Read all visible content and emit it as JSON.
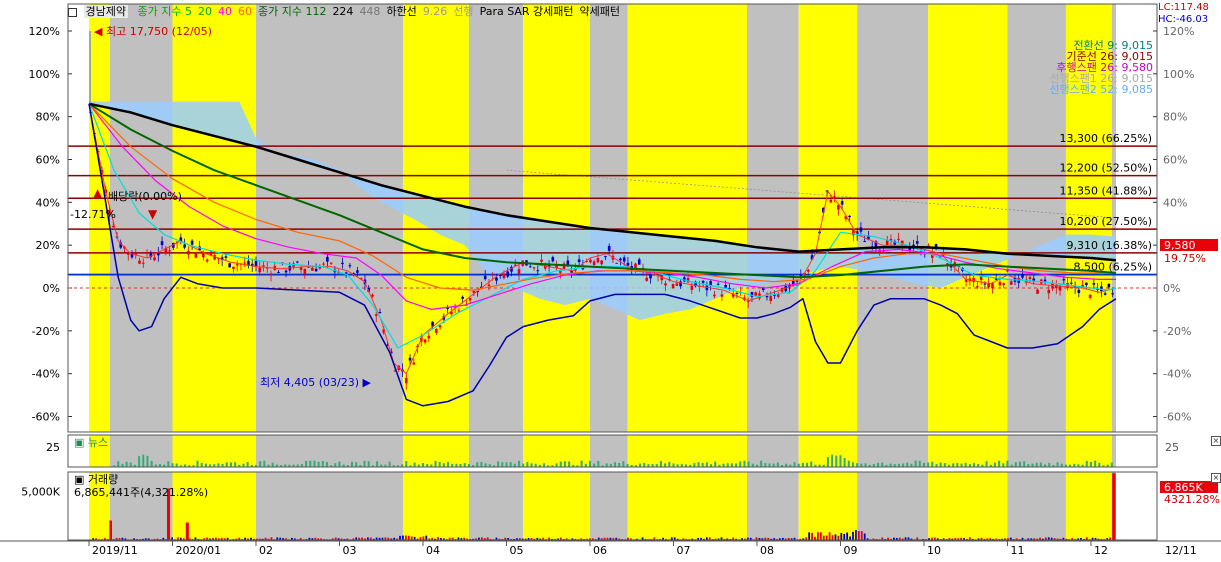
{
  "stock_name": "경남제약",
  "legend_main": [
    {
      "text": "종가 지수 5",
      "color": "#00aa00"
    },
    {
      "text": "20",
      "color": "#00aa00"
    },
    {
      "text": "40",
      "color": "#ff00ff"
    },
    {
      "text": "60",
      "color": "#ff6600"
    },
    {
      "text": "종가 지수 112",
      "color": "#006600"
    },
    {
      "text": "224",
      "color": "#000000"
    },
    {
      "text": "448",
      "color": "#777777"
    },
    {
      "text": "하한선",
      "color": "#000000"
    },
    {
      "text": "9.26",
      "color": "#999999"
    },
    {
      "text": "선행",
      "color": "#999999"
    },
    {
      "text": "Para SAR 강세패턴",
      "color": "#000000"
    },
    {
      "text": "약세패턴",
      "color": "#000000"
    }
  ],
  "lc_label": "LC:117.48",
  "hc_label": "HC:-46.03",
  "ichimoku_labels": [
    {
      "text": "전환선 9: 9,015",
      "color": "#008080"
    },
    {
      "text": "기준선 26: 9,015",
      "color": "#880000"
    },
    {
      "text": "후행스팬 26: 9,580",
      "color": "#cc00cc"
    },
    {
      "text": "선행스팬1 26: 9,015",
      "color": "#aaaaaa"
    },
    {
      "text": "선행스팬2 52: 9,085",
      "color": "#66aaff"
    }
  ],
  "max_label": "최고 17,750 (12/05)",
  "min_label": "최저 4,405 (03/23)",
  "dividend_label": "배당락(0.00%)",
  "first_pct_label": "-12.71%",
  "price_levels": [
    {
      "text": "13,300 (66.25%)",
      "pct": 66.25
    },
    {
      "text": "12,200 (52.50%)",
      "pct": 52.5
    },
    {
      "text": "11,350 (41.88%)",
      "pct": 41.88
    },
    {
      "text": "10,200 (27.50%)",
      "pct": 27.5
    },
    {
      "text": "9,310 (16.38%)",
      "pct": 16.38
    },
    {
      "text": "8,500 (6.25%)",
      "pct": 6.25
    }
  ],
  "current_price_label": "9,580",
  "current_pct_label": "19.75%",
  "news_title": "뉴스",
  "volume_title": "거래량",
  "volume_info": "6,865,441주(4,321.28%)",
  "volume_right_label": "6,865K",
  "volume_right_pct": "4321.28%",
  "date_right": "12/11",
  "colors": {
    "yellow_band": "#ffff00",
    "gray_band": "#c0c0c0",
    "up": "#e8000b",
    "down": "#0000cc",
    "ichimoku_cloud": "#99ccff",
    "level_line": "#8b0000",
    "blue_line": "#0033cc",
    "news_bar": "#33aa77"
  },
  "chart_data": {
    "type": "line",
    "title": "경남제약",
    "xlabel": "",
    "ylabel": "",
    "ylim": [
      -65,
      130
    ],
    "y_ticks": [
      120,
      100,
      80,
      60,
      40,
      20,
      0,
      -20,
      -40,
      -60
    ],
    "y_tick_labels": [
      "120%",
      "100%",
      "80%",
      "60%",
      "40%",
      "20%",
      "0%",
      "-20%",
      "-40%",
      "-60%"
    ],
    "x_range": [
      0,
      12.3
    ],
    "x_ticks": [
      {
        "x": 0,
        "label": "2019/11"
      },
      {
        "x": 1,
        "label": "2020/01"
      },
      {
        "x": 2,
        "label": "02"
      },
      {
        "x": 3,
        "label": "03"
      },
      {
        "x": 4,
        "label": "04"
      },
      {
        "x": 5,
        "label": "05"
      },
      {
        "x": 6,
        "label": "06"
      },
      {
        "x": 7,
        "label": "07"
      },
      {
        "x": 8,
        "label": "08"
      },
      {
        "x": 9,
        "label": "09"
      },
      {
        "x": 10,
        "label": "10"
      },
      {
        "x": 11,
        "label": "11"
      },
      {
        "x": 12,
        "label": "12"
      }
    ],
    "bands": [
      {
        "from": 0.0,
        "to": 0.25,
        "kind": "yellow"
      },
      {
        "from": 0.25,
        "to": 1.0,
        "kind": "gray"
      },
      {
        "from": 1.0,
        "to": 2.0,
        "kind": "yellow"
      },
      {
        "from": 2.0,
        "to": 3.76,
        "kind": "gray"
      },
      {
        "from": 3.76,
        "to": 4.55,
        "kind": "yellow"
      },
      {
        "from": 4.55,
        "to": 5.2,
        "kind": "gray"
      },
      {
        "from": 5.2,
        "to": 6.0,
        "kind": "yellow"
      },
      {
        "from": 6.0,
        "to": 6.45,
        "kind": "gray"
      },
      {
        "from": 6.45,
        "to": 7.88,
        "kind": "yellow"
      },
      {
        "from": 7.88,
        "to": 8.5,
        "kind": "gray"
      },
      {
        "from": 8.5,
        "to": 9.2,
        "kind": "yellow"
      },
      {
        "from": 9.2,
        "to": 10.05,
        "kind": "gray"
      },
      {
        "from": 10.05,
        "to": 10.75,
        "kind": "yellow"
      },
      {
        "from": 10.75,
        "to": 11.7,
        "kind": "yellow"
      },
      {
        "from": 11.0,
        "to": 11.7,
        "kind": "gray"
      },
      {
        "from": 11.7,
        "to": 12.25,
        "kind": "yellow"
      },
      {
        "from": 12.25,
        "to": 12.3,
        "kind": "gray"
      }
    ],
    "series": [
      {
        "name": "5",
        "color": "#ff3333",
        "width": 1,
        "x": [
          0,
          0.2,
          0.35,
          0.5,
          0.7,
          0.9,
          1.1,
          1.4,
          1.7,
          2.0,
          2.3,
          2.6,
          2.9,
          3.1,
          3.3,
          3.5,
          3.65,
          3.8,
          4.0,
          4.3,
          4.6,
          4.9,
          5.2,
          5.5,
          5.8,
          6.0,
          6.2,
          6.5,
          6.8,
          7.0,
          7.3,
          7.6,
          7.9,
          8.2,
          8.5,
          8.7,
          8.85,
          9.0,
          9.2,
          9.5,
          9.8,
          10.0,
          10.2,
          10.5,
          10.8,
          11.0,
          11.3,
          11.6,
          11.9,
          12.1,
          12.3
        ],
        "y": [
          86,
          45,
          22,
          16,
          14,
          18,
          22,
          16,
          12,
          10,
          9,
          10,
          10,
          8,
          3,
          -15,
          -35,
          -40,
          -22,
          -12,
          -3,
          6,
          12,
          10,
          8,
          14,
          16,
          9,
          6,
          3,
          1,
          -1,
          -6,
          -2,
          2,
          16,
          45,
          38,
          25,
          20,
          20,
          18,
          16,
          4,
          2,
          6,
          2,
          1,
          0,
          -2,
          0
        ]
      },
      {
        "name": "20",
        "color": "#00dddd",
        "width": 1.2,
        "x": [
          0,
          0.3,
          0.6,
          0.9,
          1.2,
          1.6,
          2.0,
          2.4,
          2.8,
          3.1,
          3.4,
          3.7,
          4.0,
          4.4,
          4.8,
          5.2,
          5.6,
          6.0,
          6.4,
          6.8,
          7.2,
          7.6,
          8.0,
          8.4,
          8.7,
          9.0,
          9.4,
          9.8,
          10.2,
          10.6,
          11.0,
          11.4,
          11.8,
          12.2,
          12.3
        ],
        "y": [
          86,
          55,
          35,
          25,
          20,
          16,
          13,
          11,
          10,
          6,
          -8,
          -28,
          -22,
          -12,
          -4,
          4,
          8,
          10,
          10,
          7,
          3,
          0,
          -4,
          -2,
          8,
          26,
          24,
          20,
          14,
          6,
          4,
          3,
          1,
          -1,
          0
        ]
      },
      {
        "name": "40",
        "color": "#ff00ff",
        "width": 1.2,
        "x": [
          0,
          0.4,
          0.8,
          1.2,
          1.6,
          2.0,
          2.4,
          2.8,
          3.2,
          3.5,
          3.8,
          4.1,
          4.5,
          4.9,
          5.3,
          5.7,
          6.1,
          6.5,
          6.9,
          7.3,
          7.7,
          8.1,
          8.5,
          8.9,
          9.3,
          9.7,
          10.1,
          10.5,
          10.9,
          11.3,
          11.7,
          12.1,
          12.3
        ],
        "y": [
          86,
          66,
          50,
          38,
          29,
          23,
          19,
          16,
          14,
          6,
          -6,
          -10,
          -8,
          -3,
          2,
          6,
          8,
          8,
          7,
          5,
          2,
          0,
          2,
          10,
          17,
          18,
          16,
          12,
          9,
          7,
          5,
          4,
          4
        ]
      },
      {
        "name": "60",
        "color": "#ff6600",
        "width": 1.2,
        "x": [
          0,
          0.5,
          1.0,
          1.5,
          2.0,
          2.5,
          3.0,
          3.4,
          3.8,
          4.2,
          4.6,
          5.0,
          5.4,
          5.8,
          6.2,
          6.6,
          7.0,
          7.4,
          7.8,
          8.2,
          8.6,
          9.0,
          9.4,
          9.8,
          10.2,
          10.6,
          11.0,
          11.4,
          11.8,
          12.3
        ],
        "y": [
          86,
          66,
          51,
          40,
          32,
          26,
          22,
          15,
          5,
          0,
          -1,
          2,
          5,
          7,
          8,
          8,
          7,
          6,
          4,
          3,
          4,
          10,
          14,
          16,
          16,
          13,
          10,
          8,
          7,
          7
        ]
      },
      {
        "name": "112",
        "color": "#006600",
        "width": 2,
        "x": [
          0,
          0.5,
          1.0,
          1.5,
          2.0,
          2.5,
          3.0,
          3.5,
          4.0,
          4.5,
          5.0,
          5.5,
          6.0,
          6.5,
          7.0,
          7.5,
          8.0,
          8.5,
          9.0,
          9.5,
          10.0,
          10.5,
          11.0,
          11.5,
          12.0,
          12.3
        ],
        "y": [
          86,
          74,
          64,
          55,
          48,
          41,
          34,
          26,
          18,
          14,
          12,
          11,
          10,
          9,
          8,
          7,
          6,
          5,
          6,
          8,
          10,
          11,
          10,
          9,
          8,
          7
        ]
      },
      {
        "name": "224",
        "color": "#000000",
        "width": 2.5,
        "x": [
          0,
          0.5,
          1.0,
          1.5,
          2.0,
          2.5,
          3.0,
          3.5,
          4.0,
          4.5,
          5.0,
          5.5,
          6.0,
          6.5,
          7.0,
          7.5,
          8.0,
          8.5,
          9.0,
          9.5,
          10.0,
          10.5,
          11.0,
          11.5,
          12.0,
          12.3
        ],
        "y": [
          86,
          82,
          76,
          71,
          66,
          60,
          54,
          48,
          43,
          38,
          34,
          31,
          28,
          26,
          24,
          22,
          19,
          17,
          18,
          19,
          19,
          18,
          16,
          15,
          14,
          13
        ]
      },
      {
        "name": "하한선",
        "color": "#0000aa",
        "width": 1.5,
        "x": [
          0,
          0.2,
          0.35,
          0.5,
          0.6,
          0.75,
          0.9,
          1.1,
          1.3,
          1.6,
          2.0,
          2.5,
          3.0,
          3.3,
          3.6,
          3.8,
          4.0,
          4.3,
          4.6,
          4.8,
          5.0,
          5.2,
          5.5,
          5.8,
          6.0,
          6.3,
          6.6,
          6.9,
          7.2,
          7.5,
          7.8,
          8.0,
          8.2,
          8.4,
          8.55,
          8.7,
          8.85,
          9.0,
          9.2,
          9.4,
          9.6,
          9.8,
          10.0,
          10.2,
          10.4,
          10.6,
          10.8,
          11.0,
          11.3,
          11.6,
          11.9,
          12.1,
          12.3
        ],
        "y": [
          86,
          40,
          5,
          -15,
          -20,
          -18,
          -5,
          5,
          2,
          0,
          0,
          -1,
          -2,
          -8,
          -30,
          -52,
          -55,
          -53,
          -48,
          -36,
          -23,
          -18,
          -15,
          -13,
          -6,
          -3,
          -3,
          -3,
          -6,
          -10,
          -14,
          -14,
          -12,
          -9,
          -5,
          -25,
          -35,
          -35,
          -20,
          -8,
          -5,
          -5,
          -5,
          -8,
          -12,
          -22,
          -25,
          -28,
          -28,
          -26,
          -18,
          -10,
          -5
        ]
      },
      {
        "name": "선행",
        "color": "#99ccff",
        "width": 1,
        "x": [
          0,
          0.3,
          0.6,
          0.9,
          1.2,
          1.5,
          1.8,
          2.0,
          2.2,
          2.4,
          2.7,
          3.0,
          3.3,
          3.6,
          3.9,
          4.2,
          4.5,
          4.8,
          5.1,
          5.4,
          5.7,
          6.0,
          6.3,
          6.6,
          6.9,
          7.2,
          7.5,
          7.8,
          8.1,
          8.4,
          8.7,
          9.0,
          9.3,
          9.6,
          9.9,
          10.2,
          10.5,
          10.8,
          11.1,
          11.4,
          11.7,
          12.0,
          12.3
        ],
        "y": [
          87,
          87,
          87,
          87,
          87,
          87,
          87,
          70,
          64,
          62,
          60,
          55,
          45,
          38,
          32,
          25,
          20,
          5,
          0,
          -5,
          -8,
          -5,
          -10,
          -15,
          -12,
          -10,
          -5,
          0,
          2,
          5,
          8,
          10,
          8,
          5,
          2,
          0,
          5,
          10,
          15,
          20,
          25,
          25,
          24
        ]
      }
    ],
    "volume_max": 7000,
    "volume_y_ticks": [
      {
        "v": 5000,
        "label": "5,000K"
      }
    ],
    "volume_spikes": [
      {
        "x": 0.26,
        "v": 2000
      },
      {
        "x": 0.95,
        "v": 5300
      },
      {
        "x": 1.18,
        "v": 1800
      },
      {
        "x": 12.28,
        "v": 6865
      }
    ],
    "news_y_ticks": [
      {
        "v": 25,
        "label": "25"
      }
    ],
    "news_max": 40
  }
}
